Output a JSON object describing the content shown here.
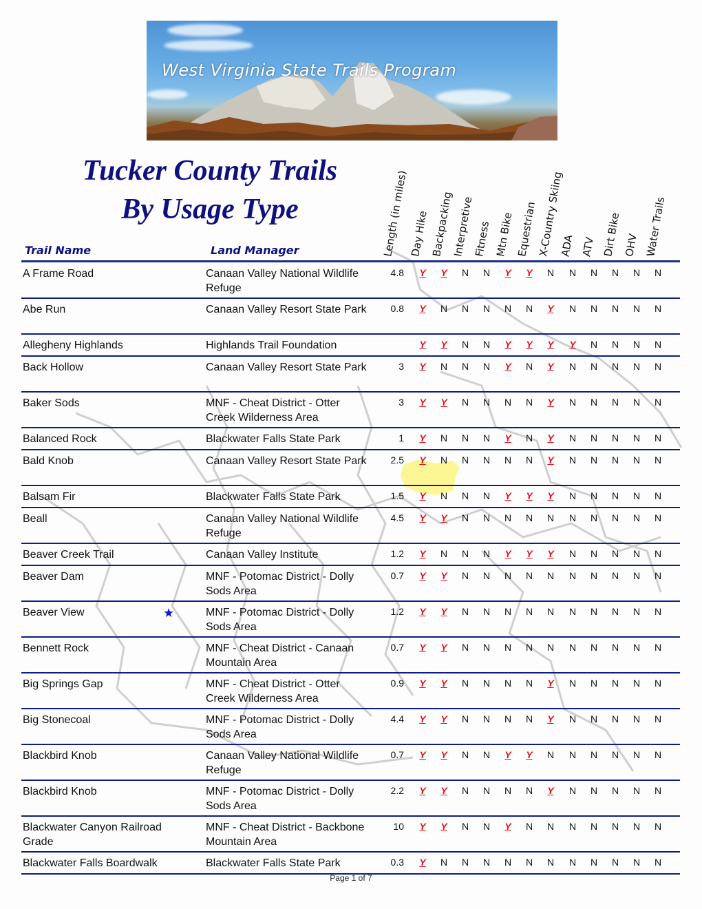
{
  "banner": {
    "title": "West Virginia State Trails Program"
  },
  "title": {
    "line1": "Tucker County Trails",
    "line2": "By Usage Type"
  },
  "headers": {
    "trail_name": "Trail Name",
    "land_manager": "Land Manager",
    "usage_columns": [
      "Length (in miles)",
      "Day Hike",
      "Backpacking",
      "Interpretive",
      "Fitness",
      "Mtn Bike",
      "Equestrian",
      "X-Country Skiing",
      "ADA",
      "ATV",
      "Dirt Bike",
      "OHV",
      "Water Trails"
    ]
  },
  "colors": {
    "title": "#0f0f80",
    "rule": "#0e1c86",
    "yes": "#e4101a",
    "star": "#1010e0"
  },
  "rows": [
    {
      "name": "A Frame Road",
      "manager": "Canaan Valley National Wildlife Refuge",
      "length": "4.8",
      "flags": [
        "Y",
        "Y",
        "N",
        "N",
        "Y",
        "Y",
        "N",
        "N",
        "N",
        "N",
        "N",
        "N"
      ]
    },
    {
      "name": "Abe Run",
      "manager": "Canaan Valley Resort State Park",
      "length": "0.8",
      "flags": [
        "Y",
        "N",
        "N",
        "N",
        "N",
        "N",
        "Y",
        "N",
        "N",
        "N",
        "N",
        "N"
      ]
    },
    {
      "name": "Allegheny Highlands",
      "manager": "Highlands Trail Foundation",
      "length": "",
      "flags": [
        "Y",
        "Y",
        "N",
        "N",
        "Y",
        "Y",
        "Y",
        "Y",
        "N",
        "N",
        "N",
        "N"
      ]
    },
    {
      "name": "Back Hollow",
      "manager": "Canaan Valley Resort State Park",
      "length": "3",
      "flags": [
        "Y",
        "N",
        "N",
        "N",
        "Y",
        "N",
        "Y",
        "N",
        "N",
        "N",
        "N",
        "N"
      ]
    },
    {
      "name": "Baker Sods",
      "manager": "MNF - Cheat District - Otter Creek Wilderness Area",
      "length": "3",
      "flags": [
        "Y",
        "Y",
        "N",
        "N",
        "N",
        "N",
        "Y",
        "N",
        "N",
        "N",
        "N",
        "N"
      ]
    },
    {
      "name": "Balanced Rock",
      "manager": "Blackwater Falls State Park",
      "length": "1",
      "flags": [
        "Y",
        "N",
        "N",
        "N",
        "Y",
        "N",
        "Y",
        "N",
        "N",
        "N",
        "N",
        "N"
      ]
    },
    {
      "name": "Bald Knob",
      "manager": "Canaan Valley Resort State Park",
      "length": "2.5",
      "flags": [
        "Y",
        "N",
        "N",
        "N",
        "N",
        "N",
        "Y",
        "N",
        "N",
        "N",
        "N",
        "N"
      ]
    },
    {
      "name": "Balsam Fir",
      "manager": "Blackwater Falls State Park",
      "length": "1.5",
      "flags": [
        "Y",
        "N",
        "N",
        "N",
        "Y",
        "Y",
        "Y",
        "N",
        "N",
        "N",
        "N",
        "N"
      ]
    },
    {
      "name": "Beall",
      "manager": "Canaan Valley National Wildlife Refuge",
      "length": "4.5",
      "flags": [
        "Y",
        "Y",
        "N",
        "N",
        "N",
        "N",
        "N",
        "N",
        "N",
        "N",
        "N",
        "N"
      ]
    },
    {
      "name": "Beaver Creek Trail",
      "manager": "Canaan Valley Institute",
      "length": "1.2",
      "flags": [
        "Y",
        "N",
        "N",
        "N",
        "Y",
        "Y",
        "Y",
        "N",
        "N",
        "N",
        "N",
        "N"
      ]
    },
    {
      "name": "Beaver Dam",
      "manager": "MNF - Potomac District - Dolly Sods Area",
      "length": "0.7",
      "flags": [
        "Y",
        "Y",
        "N",
        "N",
        "N",
        "N",
        "N",
        "N",
        "N",
        "N",
        "N",
        "N"
      ]
    },
    {
      "name": "Beaver View",
      "manager": "MNF - Potomac District - Dolly Sods Area",
      "length": "1.2",
      "star": true,
      "flags": [
        "Y",
        "Y",
        "N",
        "N",
        "N",
        "N",
        "N",
        "N",
        "N",
        "N",
        "N",
        "N"
      ]
    },
    {
      "name": "Bennett Rock",
      "manager": "MNF - Cheat District - Canaan Mountain Area",
      "length": "0.7",
      "flags": [
        "Y",
        "Y",
        "N",
        "N",
        "N",
        "N",
        "N",
        "N",
        "N",
        "N",
        "N",
        "N"
      ]
    },
    {
      "name": "Big Springs Gap",
      "manager": "MNF - Cheat District - Otter Creek Wilderness Area",
      "length": "0.9",
      "flags": [
        "Y",
        "Y",
        "N",
        "N",
        "N",
        "N",
        "Y",
        "N",
        "N",
        "N",
        "N",
        "N"
      ]
    },
    {
      "name": "Big Stonecoal",
      "manager": "MNF - Potomac District - Dolly Sods Area",
      "length": "4.4",
      "flags": [
        "Y",
        "Y",
        "N",
        "N",
        "N",
        "N",
        "Y",
        "N",
        "N",
        "N",
        "N",
        "N"
      ]
    },
    {
      "name": "Blackbird Knob",
      "manager": "Canaan Valley National Wildlife Refuge",
      "length": "0.7",
      "flags": [
        "Y",
        "Y",
        "N",
        "N",
        "Y",
        "Y",
        "N",
        "N",
        "N",
        "N",
        "N",
        "N"
      ]
    },
    {
      "name": "Blackbird Knob",
      "manager": "MNF - Potomac District - Dolly Sods Area",
      "length": "2.2",
      "flags": [
        "Y",
        "Y",
        "N",
        "N",
        "N",
        "N",
        "Y",
        "N",
        "N",
        "N",
        "N",
        "N"
      ]
    },
    {
      "name": "Blackwater Canyon Railroad Grade",
      "manager": "MNF - Cheat District - Backbone Mountain Area",
      "length": "10",
      "flags": [
        "Y",
        "Y",
        "N",
        "N",
        "Y",
        "N",
        "N",
        "N",
        "N",
        "N",
        "N",
        "N"
      ]
    },
    {
      "name": "Blackwater Falls Boardwalk",
      "manager": "Blackwater Falls State Park",
      "length": "0.3",
      "flags": [
        "Y",
        "N",
        "N",
        "N",
        "N",
        "N",
        "N",
        "N",
        "N",
        "N",
        "N",
        "N"
      ]
    }
  ],
  "footer": {
    "page_label": "Page 1 of 7"
  }
}
